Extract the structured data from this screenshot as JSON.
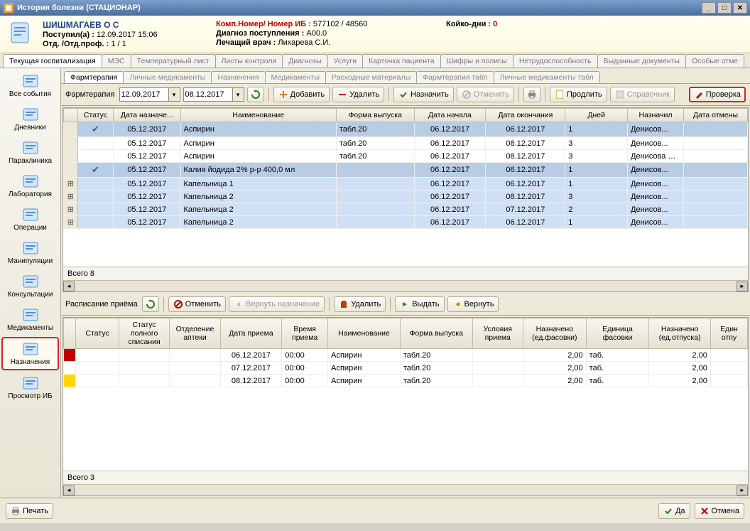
{
  "window": {
    "title": "История болезни (СТАЦИОНАР)"
  },
  "patient": {
    "name": "ШИШМАГАЕВ О С",
    "admitted_label": "Поступил(а) :",
    "admitted_value": "12.09.2017 15:06",
    "dept_label": "Отд. /Отд.проф. :",
    "dept_value": "1 / 1",
    "komp_label": "Комп.Номер/ Номер ИБ :",
    "komp_value": "577102 / 48560",
    "diag_label": "Диагноз поступления :",
    "diag_value": "A00.0",
    "doctor_label": "Лечащий врач :",
    "doctor_value": "Лихарева С.И.",
    "beddays_label": "Койко-дни :",
    "beddays_value": "0"
  },
  "main_tabs": [
    "Текущая госпитализация",
    "МЭС",
    "Температурный лист",
    "Листы контроля",
    "Диагнозы",
    "Услуги",
    "Карточка пациента",
    "Шифры и полисы",
    "Нетрудоспособность",
    "Выданные документы",
    "Особые отме"
  ],
  "main_tab_active": 0,
  "sidebar": {
    "items": [
      {
        "label": "Все события"
      },
      {
        "label": "Дневники"
      },
      {
        "label": "Параклиника"
      },
      {
        "label": "Лаборатория"
      },
      {
        "label": "Операции"
      },
      {
        "label": "Манипуляции"
      },
      {
        "label": "Консультации"
      },
      {
        "label": "Медикаменты"
      },
      {
        "label": "Назначения"
      },
      {
        "label": "Просмотр ИБ"
      }
    ],
    "selected": 8
  },
  "sub_tabs": [
    "Фармтерапия",
    "Личные медикаменты",
    "Назначения",
    "Медикаменты",
    "Расходные материалы",
    "Фармтерапия табл",
    "Личные медикаменты табл"
  ],
  "sub_tab_active": 0,
  "toolbar1": {
    "section": "Фармтерапия",
    "date_from": "12.09.2017",
    "date_to": "08.12.2017",
    "add": "Добавить",
    "delete": "Удалить",
    "assign": "Назначить",
    "cancel": "Отменить",
    "extend": "Продлить",
    "reference": "Справочник",
    "check": "Проверка"
  },
  "grid1": {
    "cols": [
      "",
      "Статус",
      "Дата назначе...",
      "Наименование",
      "Форма выпуска",
      "Дата начала",
      "Дата окончания",
      "Дней",
      "Назначил",
      "Дата отмены"
    ],
    "rows": [
      {
        "cls": "r-selected",
        "mark": "✔",
        "date": "05.12.2017",
        "name": "Аспирин",
        "form": "табл.20",
        "start": "06.12.2017",
        "end": "06.12.2017",
        "days": "1",
        "by": "Денисов..."
      },
      {
        "cls": "",
        "mark": "",
        "date": "05.12.2017",
        "name": "Аспирин",
        "form": "табл.20",
        "start": "06.12.2017",
        "end": "08.12.2017",
        "days": "3",
        "by": "Денисов..."
      },
      {
        "cls": "",
        "mark": "",
        "date": "05.12.2017",
        "name": "Аспирин",
        "form": "табл.20",
        "start": "06.12.2017",
        "end": "08.12.2017",
        "days": "3",
        "by": "Денисова Елена Геннадь..."
      },
      {
        "cls": "r-selected",
        "mark": "✔",
        "date": "05.12.2017",
        "name": "Калия йодида 2% р-р 400,0 мл",
        "form": "",
        "start": "06.12.2017",
        "end": "06.12.2017",
        "days": "1",
        "by": "Денисов..."
      },
      {
        "cls": "r-blue",
        "mark": "+",
        "date": "05.12.2017",
        "name": "Капельница 1",
        "form": "",
        "start": "06.12.2017",
        "end": "06.12.2017",
        "days": "1",
        "by": "Денисов..."
      },
      {
        "cls": "r-blue",
        "mark": "+",
        "date": "05.12.2017",
        "name": "Капельница 2",
        "form": "",
        "start": "06.12.2017",
        "end": "08.12.2017",
        "days": "3",
        "by": "Денисов..."
      },
      {
        "cls": "r-blue",
        "mark": "+",
        "date": "05.12.2017",
        "name": "Капельница 2",
        "form": "",
        "start": "06.12.2017",
        "end": "07.12.2017",
        "days": "2",
        "by": "Денисов..."
      },
      {
        "cls": "r-blue",
        "mark": "+",
        "date": "05.12.2017",
        "name": "Капельница 2",
        "form": "",
        "start": "06.12.2017",
        "end": "06.12.2017",
        "days": "1",
        "by": "Денисов..."
      }
    ],
    "total_label": "Всего 8"
  },
  "toolbar2": {
    "section": "Расписание приёма",
    "cancel": "Отменить",
    "return_assign": "Вернуть назначение",
    "delete": "Удалить",
    "issue": "Выдать",
    "return": "Вернуть"
  },
  "grid2": {
    "cols": [
      "",
      "Статус",
      "Статус полного списания",
      "Отделение аптеки",
      "Дата приема",
      "Время приема",
      "Наименование",
      "Форма выпуска",
      "Условия приема",
      "Назначено (ед.фасовки)",
      "Единица фасовки",
      "Назначено (ед.отпуска)",
      "Един отпу"
    ],
    "rows": [
      {
        "color": "red",
        "date": "06.12.2017",
        "time": "00:00",
        "name": "Аспирин",
        "form": "табл.20",
        "assigned": "2,00",
        "unit": "таб.",
        "assigned2": "2,00"
      },
      {
        "color": "",
        "date": "07.12.2017",
        "time": "00:00",
        "name": "Аспирин",
        "form": "табл.20",
        "assigned": "2,00",
        "unit": "таб.",
        "assigned2": "2,00"
      },
      {
        "color": "yellow",
        "date": "08.12.2017",
        "time": "00:00",
        "name": "Аспирин",
        "form": "табл.20",
        "assigned": "2,00",
        "unit": "таб.",
        "assigned2": "2,00"
      }
    ],
    "total_label": "Всего 3"
  },
  "footer": {
    "print": "Печать",
    "ok": "Да",
    "cancel": "Отмена"
  }
}
